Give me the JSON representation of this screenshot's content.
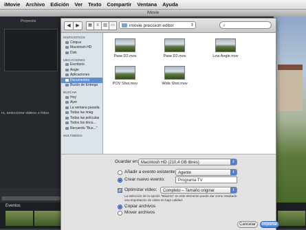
{
  "menubar": {
    "items": [
      "iMovie",
      "Archivo",
      "Edición",
      "Ver",
      "Texto",
      "Compartir",
      "Ventana",
      "Ayuda"
    ]
  },
  "background_window": {
    "title": "iMovie",
    "projects_label": "Proyectos",
    "message": "rs, seleccione videos o fotos",
    "events_label": "Eventos"
  },
  "dialog": {
    "path": "imovie precision editor",
    "search_placeholder": "",
    "sidebar": {
      "sections": [
        {
          "header": "Dispositivos",
          "items": [
            {
              "label": "Cinqua",
              "selected": false
            },
            {
              "label": "Macintosh HD",
              "selected": false
            },
            {
              "label": "Disk",
              "selected": false
            }
          ]
        },
        {
          "header": "Ubicaciones",
          "items": [
            {
              "label": "Escritorio",
              "selected": false
            },
            {
              "label": "Angie",
              "selected": false
            },
            {
              "label": "Aplicaciones",
              "selected": false
            },
            {
              "label": "Documentos",
              "selected": true
            },
            {
              "label": "Buzón de Entrega",
              "selected": false
            }
          ]
        },
        {
          "header": "Buscar",
          "items": [
            {
              "label": "Hoy",
              "selected": false
            },
            {
              "label": "Ayer",
              "selected": false
            },
            {
              "label": "La semana pasada",
              "selected": false
            },
            {
              "label": "Todas las imág",
              "selected": false
            },
            {
              "label": "Todas las películas",
              "selected": false
            },
            {
              "label": "Todos los docu...",
              "selected": false
            },
            {
              "label": "Recuerdo \"Bus...\"",
              "selected": false
            }
          ]
        },
        {
          "header": "Multimedia",
          "items": []
        }
      ]
    },
    "files": [
      {
        "name": "Pase D2.mov"
      },
      {
        "name": "Pase D2.mov"
      },
      {
        "name": "Low Angle.mov"
      },
      {
        "name": "POV Shot.mov"
      },
      {
        "name": "Wide Shot.mov"
      }
    ],
    "options": {
      "save_in_label": "Guardar en:",
      "save_in_value": "Macintosh HD (210,4 GB libres)",
      "add_to_event_label": "Añadir a evento existente:",
      "add_to_event_value": "Agente",
      "create_event_label": "Crear nuevo evento:",
      "create_event_value": "Programa TV",
      "optimize_label": "Optimizar vídeo:",
      "optimize_value": "Completo – Tamaño original",
      "note": "La selección de la opción \"Máximo\" en este elemento puede dar como resultado una importación de vídeo en baja calidad.",
      "copy_files_label": "Copiar archivos",
      "move_files_label": "Mover archivos"
    },
    "buttons": {
      "cancel": "Cancelar",
      "import": "Importar"
    }
  },
  "colors": {
    "selection": "#5f8dd3",
    "primary_button": "#3b7ae0"
  }
}
